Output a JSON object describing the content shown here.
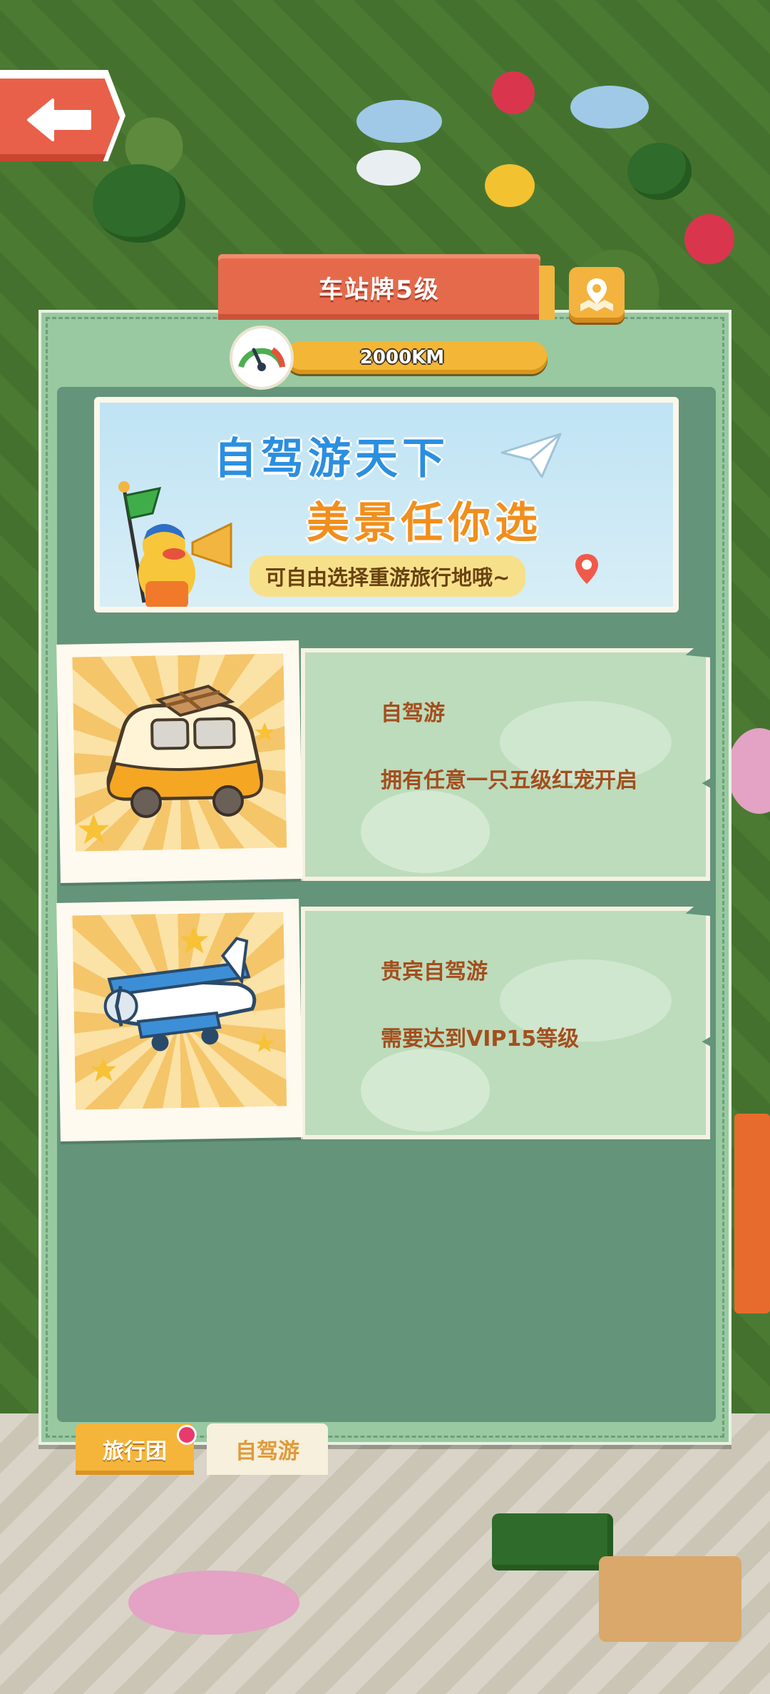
{
  "header": {
    "title": "车站牌5级",
    "back_icon": "arrow-left-icon",
    "map_icon": "map-pin-icon"
  },
  "distance": {
    "label": "2000KM",
    "icon": "speedometer-icon"
  },
  "promo": {
    "line1": "自驾游天下",
    "line2": "美景任你选",
    "subtitle": "可自由选择重游旅行地哦~"
  },
  "routes": [
    {
      "title": "自驾游",
      "requirement": "拥有任意一只五级红宠开启",
      "icon": "camper-van-icon"
    },
    {
      "title": "贵宾自驾游",
      "requirement": "需要达到VIP15等级",
      "icon": "airplane-icon"
    }
  ],
  "tabs": [
    {
      "label": "旅行团",
      "active": true,
      "has_badge": true
    },
    {
      "label": "自驾游",
      "active": false,
      "has_badge": false
    }
  ],
  "colors": {
    "panel": "#98c9a0",
    "panel_inner": "#64947a",
    "title_banner": "#e56a4c",
    "accent": "#f4b636",
    "card_text": "#a44e1e"
  }
}
